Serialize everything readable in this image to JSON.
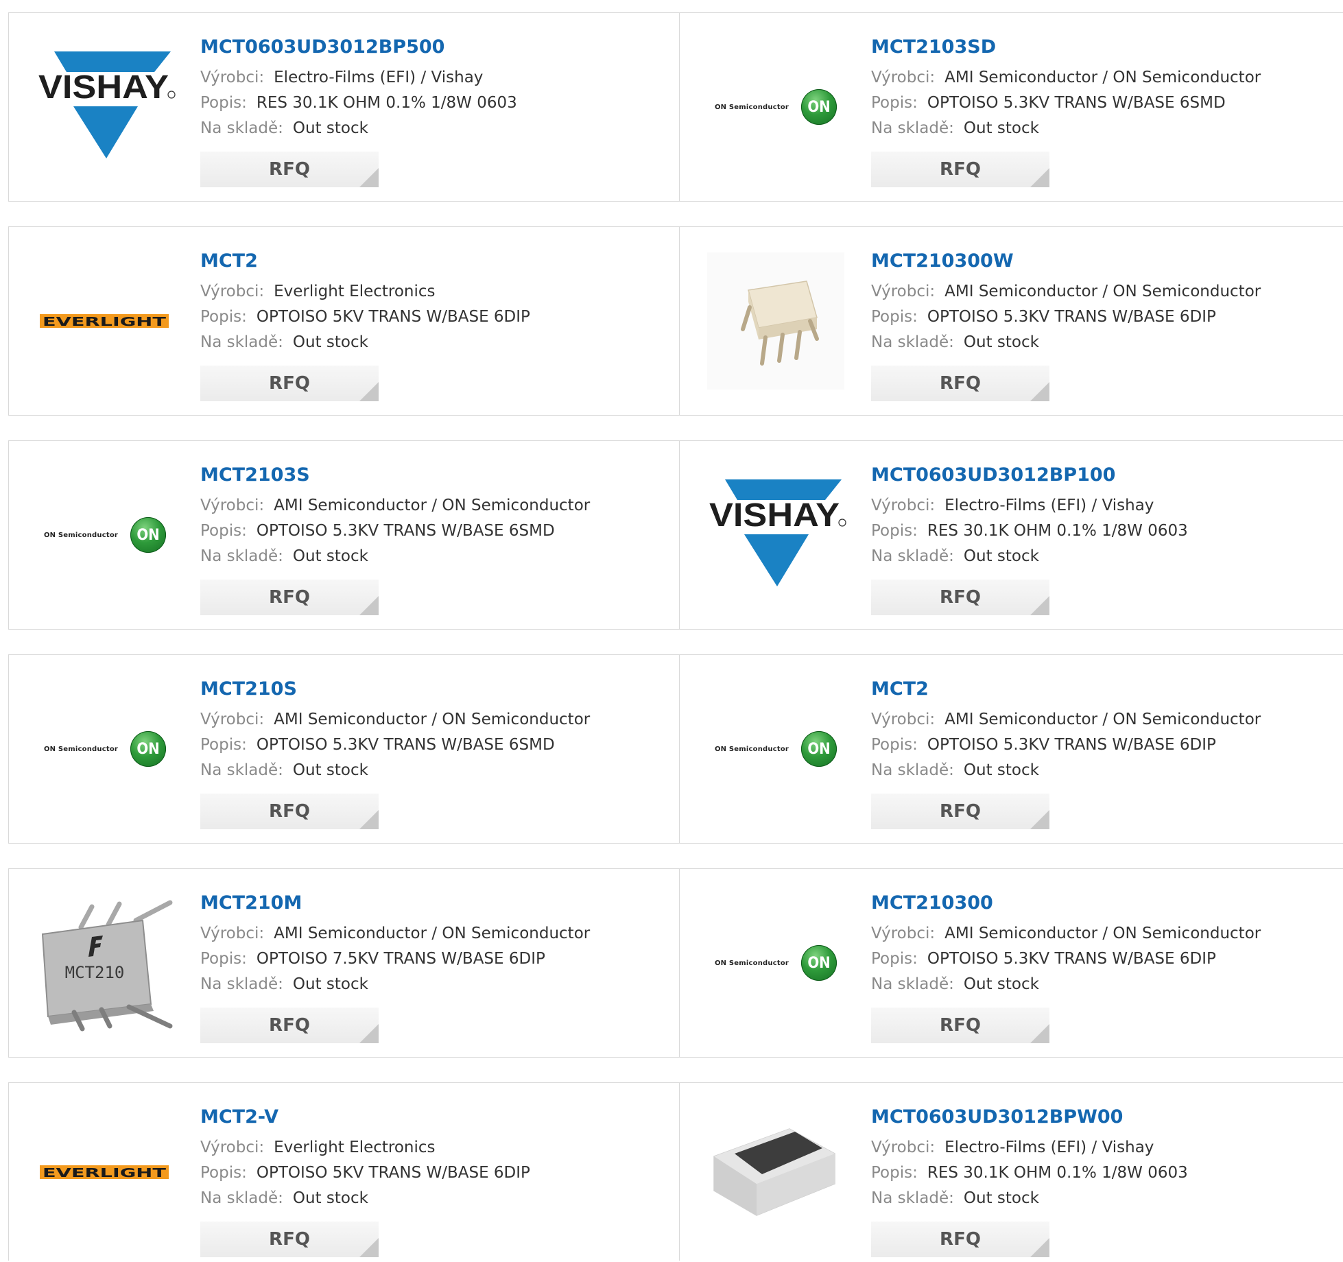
{
  "labels": {
    "manufacturer": "Výrobci:",
    "description": "Popis:",
    "stock": "Na skladě:",
    "rfq": "RFQ"
  },
  "logo_text": {
    "vishay": "VISHAY",
    "on": "ON Semiconductor",
    "on_mark": "ON",
    "everlight": "EVERLIGHT"
  },
  "products": [
    {
      "part": "MCT0603UD3012BP500",
      "manufacturer": "Electro-Films (EFI) / Vishay",
      "description": "RES 30.1K OHM 0.1% 1/8W 0603",
      "stock": "Out stock",
      "image": "vishay-logo"
    },
    {
      "part": "MCT2103SD",
      "manufacturer": "AMI Semiconductor / ON Semiconductor",
      "description": "OPTOISO 5.3KV TRANS W/BASE 6SMD",
      "stock": "Out stock",
      "image": "on-semiconductor-logo"
    },
    {
      "part": "MCT2",
      "manufacturer": "Everlight Electronics",
      "description": "OPTOISO 5KV TRANS W/BASE 6DIP",
      "stock": "Out stock",
      "image": "everlight-logo"
    },
    {
      "part": "MCT210300W",
      "manufacturer": "AMI Semiconductor / ON Semiconductor",
      "description": "OPTOISO 5.3KV TRANS W/BASE 6DIP",
      "stock": "Out stock",
      "image": "dip6-white-chip-photo"
    },
    {
      "part": "MCT2103S",
      "manufacturer": "AMI Semiconductor / ON Semiconductor",
      "description": "OPTOISO 5.3KV TRANS W/BASE 6SMD",
      "stock": "Out stock",
      "image": "on-semiconductor-logo"
    },
    {
      "part": "MCT0603UD3012BP100",
      "manufacturer": "Electro-Films (EFI) / Vishay",
      "description": "RES 30.1K OHM 0.1% 1/8W 0603",
      "stock": "Out stock",
      "image": "vishay-logo"
    },
    {
      "part": "MCT210S",
      "manufacturer": "AMI Semiconductor / ON Semiconductor",
      "description": "OPTOISO 5.3KV TRANS W/BASE 6SMD",
      "stock": "Out stock",
      "image": "on-semiconductor-logo"
    },
    {
      "part": "MCT2",
      "manufacturer": "AMI Semiconductor / ON Semiconductor",
      "description": "OPTOISO 5.3KV TRANS W/BASE 6DIP",
      "stock": "Out stock",
      "image": "on-semiconductor-logo"
    },
    {
      "part": "MCT210M",
      "manufacturer": "AMI Semiconductor / ON Semiconductor",
      "description": "OPTOISO 7.5KV TRANS W/BASE 6DIP",
      "stock": "Out stock",
      "image": "mct210-chip-photo",
      "chip_marking": "MCT210"
    },
    {
      "part": "MCT210300",
      "manufacturer": "AMI Semiconductor / ON Semiconductor",
      "description": "OPTOISO 5.3KV TRANS W/BASE 6DIP",
      "stock": "Out stock",
      "image": "on-semiconductor-logo"
    },
    {
      "part": "MCT2-V",
      "manufacturer": "Everlight Electronics",
      "description": "OPTOISO 5KV TRANS W/BASE 6DIP",
      "stock": "Out stock",
      "image": "everlight-logo"
    },
    {
      "part": "MCT0603UD3012BPW00",
      "manufacturer": "Electro-Films (EFI) / Vishay",
      "description": "RES 30.1K OHM 0.1% 1/8W 0603",
      "stock": "Out stock",
      "image": "smd-resistor-photo"
    }
  ],
  "colors": {
    "part_link": "#1467b0",
    "vishay_blue": "#1a82c4",
    "everlight_orange": "#f39a1e",
    "on_green": "#2e9a3a",
    "card_border": "#d9d9d9"
  }
}
